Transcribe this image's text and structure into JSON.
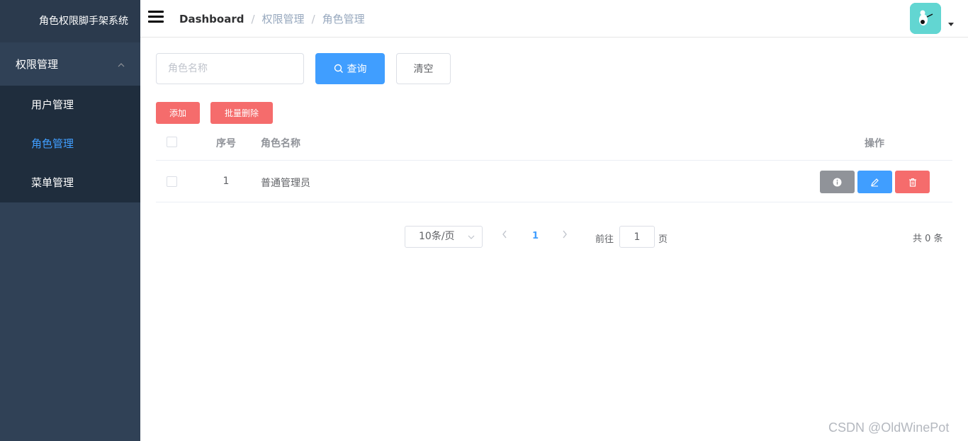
{
  "app_title": "角色权限脚手架系统",
  "sidebar": {
    "group": {
      "label": "权限管理"
    },
    "items": [
      {
        "label": "用户管理",
        "active": false
      },
      {
        "label": "角色管理",
        "active": true
      },
      {
        "label": "菜单管理",
        "active": false
      }
    ]
  },
  "breadcrumb": [
    "Dashboard",
    "权限管理",
    "角色管理"
  ],
  "search": {
    "placeholder": "角色名称",
    "value": ""
  },
  "buttons": {
    "query": "查询",
    "clear": "清空",
    "add": "添加",
    "batch_delete": "批量删除"
  },
  "table": {
    "headers": {
      "index": "序号",
      "name": "角色名称",
      "actions": "操作"
    },
    "rows": [
      {
        "index": "1",
        "name": "普通管理员"
      }
    ]
  },
  "pagination": {
    "page_size": "10条/页",
    "current_page": "1",
    "goto_label": "前往",
    "goto_value": "1",
    "goto_unit": "页",
    "total": "共 0 条"
  },
  "watermark": "CSDN @OldWinePot",
  "colors": {
    "primary": "#409eff",
    "danger": "#f56c6c",
    "info": "#909399",
    "sidebar": "#304156"
  },
  "icons": [
    "hamburger-icon",
    "chevron-up-icon",
    "search-icon",
    "caret-down-icon",
    "info-icon",
    "edit-icon",
    "delete-icon",
    "chevron-left-icon",
    "chevron-right-icon"
  ]
}
